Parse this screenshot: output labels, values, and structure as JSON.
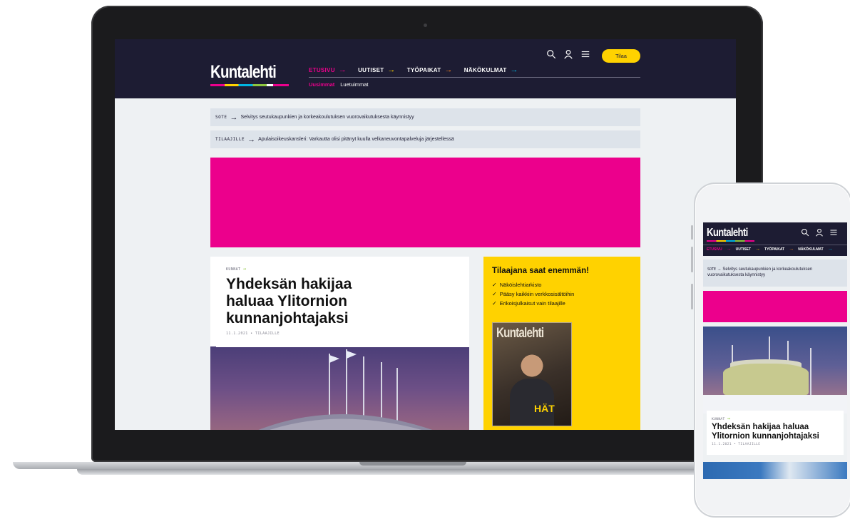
{
  "brand": {
    "logo": "Kuntalehti",
    "colors": {
      "navy": "#1d1c33",
      "magenta": "#ec008c",
      "yellow": "#ffd200",
      "lime": "#8dc63f"
    }
  },
  "nav": {
    "items": [
      {
        "label": "ETUSIVU",
        "color": "#ec008c"
      },
      {
        "label": "UUTISET",
        "color": "#ffd200"
      },
      {
        "label": "TYÖPAIKAT",
        "color": "#f58220"
      },
      {
        "label": "NÄKÖKULMAT",
        "color": "#00b5e2"
      }
    ],
    "arrow": "→",
    "sub": {
      "active": "Uusimmat",
      "other": "Luetuimmat"
    },
    "icons": [
      "search-icon",
      "user-icon",
      "menu-icon"
    ],
    "subscribe_label": "Tilaa"
  },
  "tickers": [
    {
      "tag": "SOTE",
      "text": "Selvitys seutukaupunkien ja korkeakoulutuksen vuorovaikutuksesta käynnistyy"
    },
    {
      "tag": "TILAAJILLE",
      "text": "Apulaisoikeuskansleri: Varkautta olisi pitänyt kuulla velkaneuvontapalveluja järjestellessä"
    }
  ],
  "article": {
    "kicker": "KUNNAT",
    "headline": "Yhdeksän hakijaa haluaa Ylitornion kunnanjohtajaksi",
    "meta": "11.1.2021 • TILAAJILLE"
  },
  "subscriber_box": {
    "title": "Tilaajana saat enemmän!",
    "benefits": [
      "Näköislehtiarkisto",
      "Pääsy kaikkiin verkkosisältöihin",
      "Erikoisjulkaisut vain tilaajille"
    ],
    "magazine_logo": "Kuntalehti",
    "magazine_tag": "HÄT"
  }
}
